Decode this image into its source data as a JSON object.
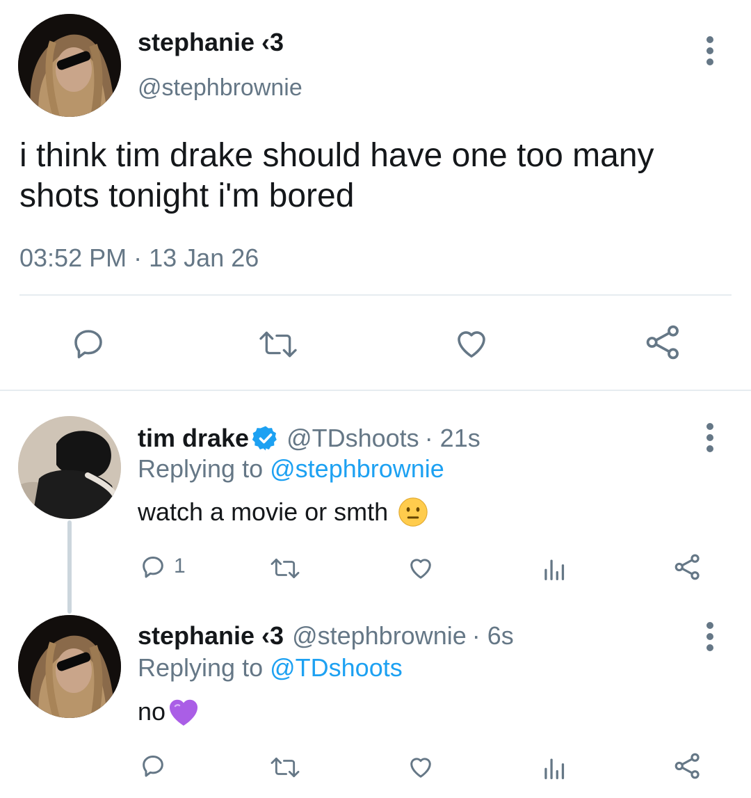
{
  "main_tweet": {
    "display_name": "stephanie ‹3",
    "handle": "@stephbrownie",
    "text_line1": "i think tim drake should have one too many",
    "text_line2": "shots tonight i'm bored",
    "time": "03:52 PM",
    "separator": "·",
    "date": "13 Jan 26",
    "icons": [
      "reply-icon",
      "retweet-icon",
      "like-icon",
      "share-icon"
    ]
  },
  "reply1": {
    "display_name": "tim drake",
    "verified": true,
    "handle": "@TDshoots",
    "meta_time": "· 21s",
    "replying_prefix": "Replying to",
    "replying_to": "@stephbrownie",
    "text": "watch a movie or smth",
    "emoji": "neutral-face",
    "reply_count": "1",
    "icons": [
      "reply-icon",
      "retweet-icon",
      "like-icon",
      "analytics-icon",
      "share-icon"
    ]
  },
  "reply2": {
    "display_name": "stephanie ‹3",
    "handle": "@stephbrownie",
    "meta_time": "· 6s",
    "replying_prefix": "Replying to",
    "replying_to": "@TDshoots",
    "text": "no",
    "emoji": "purple-heart",
    "icons": [
      "reply-icon",
      "retweet-icon",
      "like-icon",
      "analytics-icon",
      "share-icon"
    ]
  },
  "colors": {
    "text": "#14171a",
    "muted": "#657786",
    "link": "#1da1f2",
    "divider": "#e6ecf0",
    "verified": "#1da1f2"
  }
}
